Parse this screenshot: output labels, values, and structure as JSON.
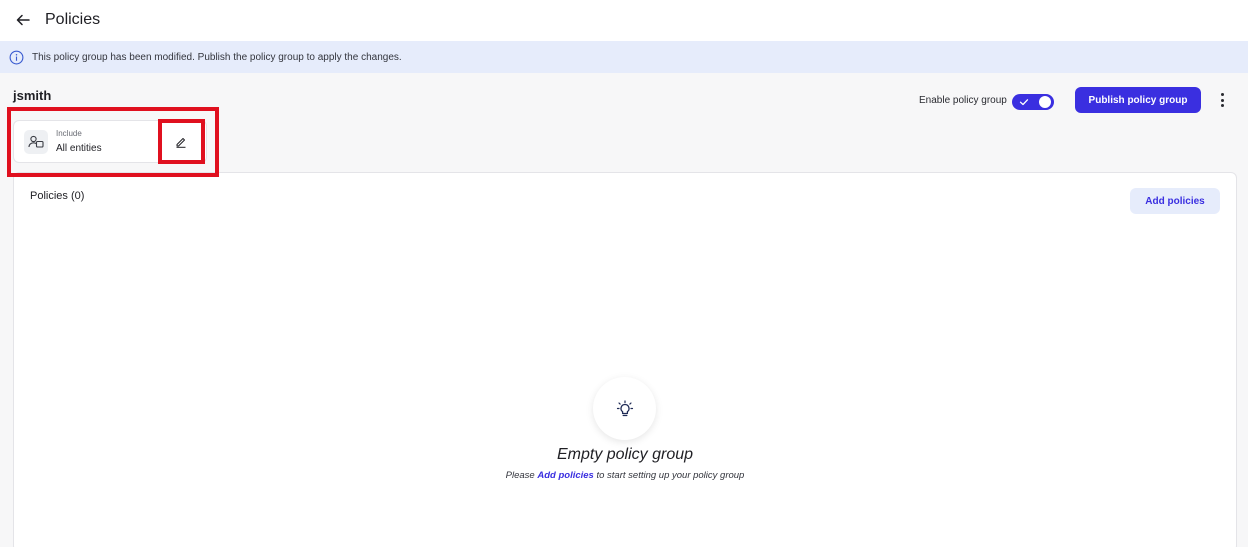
{
  "header": {
    "title": "Policies",
    "back_icon": "arrow-left-icon"
  },
  "banner": {
    "icon": "info-icon",
    "text": "This policy group has been modified. Publish the policy group to apply the changes."
  },
  "entity": {
    "name": "jsmith"
  },
  "include": {
    "label": "Include",
    "value": "All entities",
    "icon": "users-icon",
    "edit_icon": "pencil-icon"
  },
  "controls": {
    "enable_label": "Enable policy group",
    "enabled": true,
    "publish_label": "Publish policy group",
    "more_icon": "kebab-menu-icon"
  },
  "policies": {
    "title": "Policies (0)",
    "add_label": "Add policies",
    "empty_icon": "lightbulb-icon",
    "empty_title": "Empty policy group",
    "empty_prefix": "Please",
    "empty_link": "Add policies",
    "empty_suffix": "to start setting up your policy group"
  },
  "colors": {
    "accent": "#3a2fe0",
    "banner_bg": "#e6ecfb",
    "highlight": "#e0101f"
  }
}
